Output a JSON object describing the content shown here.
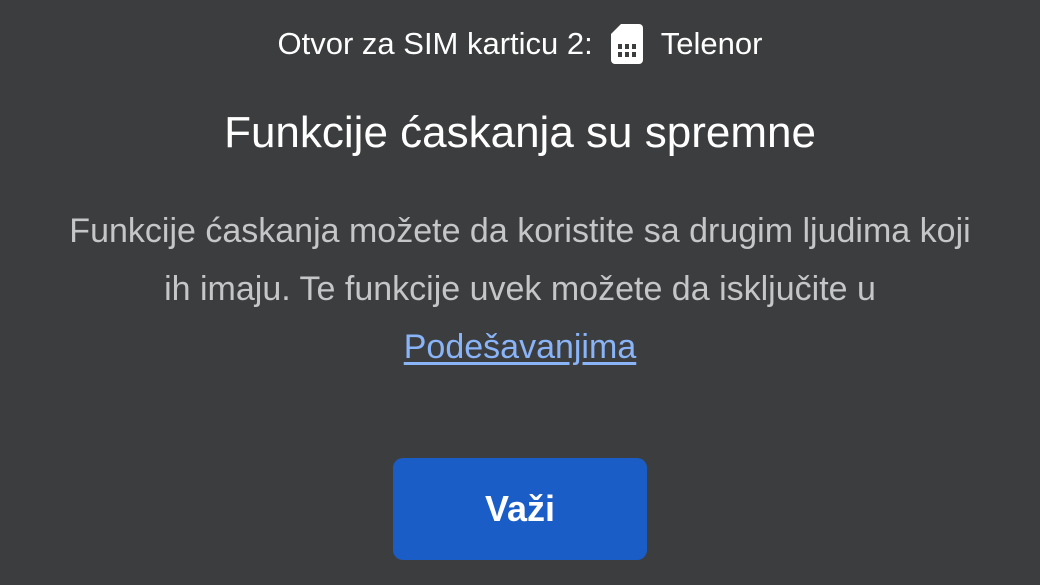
{
  "sim_info": {
    "label": "Otvor za SIM karticu 2:",
    "icon": "sim-card-icon",
    "carrier": "Telenor"
  },
  "dialog": {
    "title": "Funkcije ćaskanja su spremne",
    "body_text": "Funkcije ćaskanja možete da koristite sa drugim ljudima koji ih imaju. Te funkcije uvek možete da isključite u",
    "settings_link": "Podešavanjima"
  },
  "actions": {
    "ok_label": "Važi"
  },
  "colors": {
    "background": "#3c3d3f",
    "link": "#8ab4f8",
    "button": "#1b5dc7"
  }
}
